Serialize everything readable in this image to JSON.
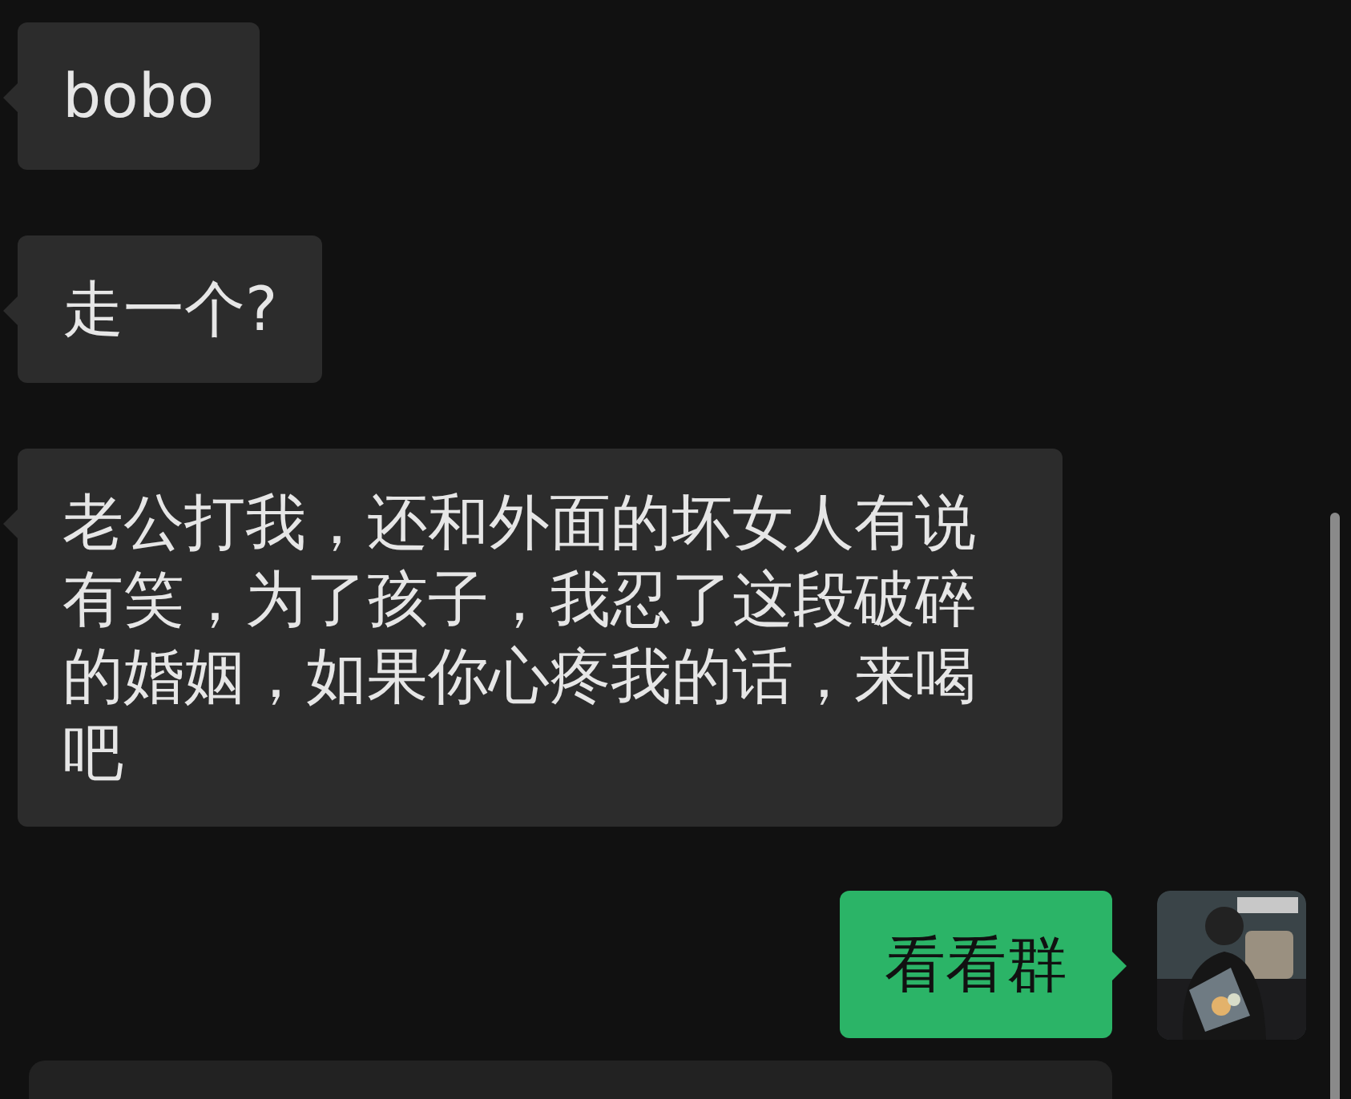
{
  "messages": [
    {
      "kind": "received",
      "text": "bobo"
    },
    {
      "kind": "received",
      "text": "走一个?"
    },
    {
      "kind": "received",
      "text": "老公打我，还和外面的坏女人有说有笑，为了孩子，我忍了这段破碎的婚姻，如果你心疼我的话，来喝吧"
    },
    {
      "kind": "sent",
      "text": "看看群"
    }
  ]
}
